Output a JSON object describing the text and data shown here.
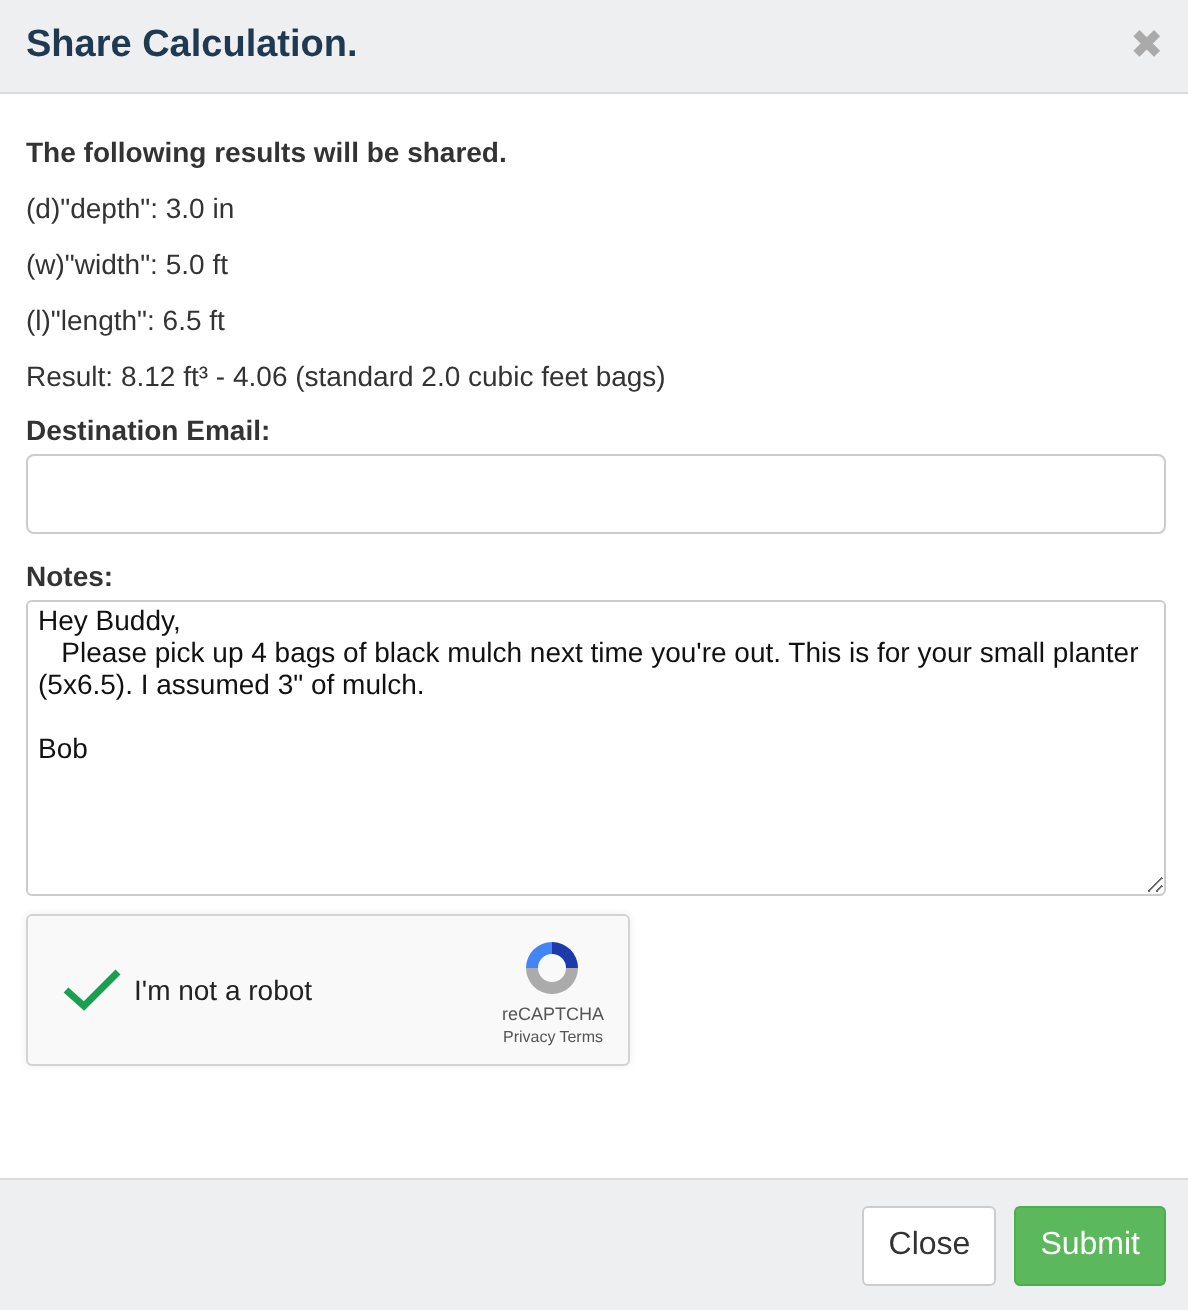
{
  "dialog": {
    "title": "Share Calculation.",
    "close_icon": "✖"
  },
  "intro": "The following results will be shared.",
  "results": [
    "(d)\"depth\": 3.0 in",
    "(w)\"width\": 5.0 ft",
    "(l)\"length\": 6.5 ft",
    "Result: 8.12 ft³ - 4.06 (standard 2.0 cubic feet bags)"
  ],
  "email": {
    "label": "Destination Email:"
  },
  "notes": {
    "label": "Notes:",
    "value": "Hey Buddy,\n   Please pick up 4 bags of black mulch next time you're out. This is for your small planter (5x6.5). I assumed 3\" of mulch.\n\nBob"
  },
  "captcha": {
    "label": "I'm not a robot",
    "checked": true,
    "brand": "reCAPTCHA",
    "links": [
      "Privacy",
      "Terms"
    ]
  },
  "buttons": [
    {
      "label": "Close",
      "kind": "default"
    },
    {
      "label": "Submit",
      "kind": "primary"
    }
  ]
}
